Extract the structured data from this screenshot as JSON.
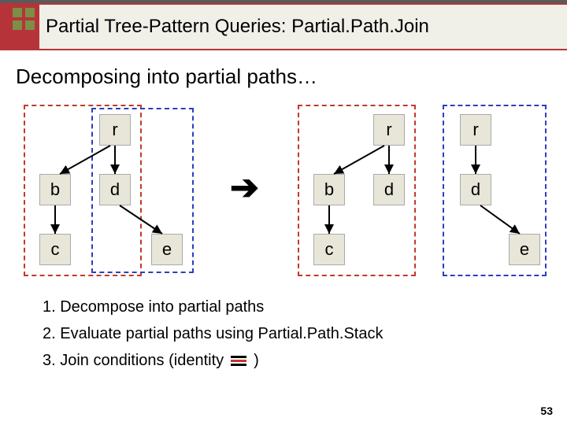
{
  "title": "Partial Tree-Pattern Queries: Partial.Path.Join",
  "subtitle": "Decomposing into partial paths…",
  "left_tree": {
    "r": "r",
    "b": "b",
    "d": "d",
    "c": "c",
    "e": "e"
  },
  "arrow_symbol": "➔",
  "right_path_red": {
    "r": "r",
    "b": "b",
    "d": "d",
    "c": "c"
  },
  "right_path_blue": {
    "r": "r",
    "d": "d",
    "e": "e"
  },
  "steps": {
    "s1": "1. Decompose into partial paths",
    "s2": "2. Evaluate partial paths using Partial.Path.Stack",
    "s3a": "3. Join conditions (identity",
    "s3b": ")"
  },
  "page_number": "53",
  "colors": {
    "red": "#c0392b",
    "blue": "#2b3fbf"
  }
}
